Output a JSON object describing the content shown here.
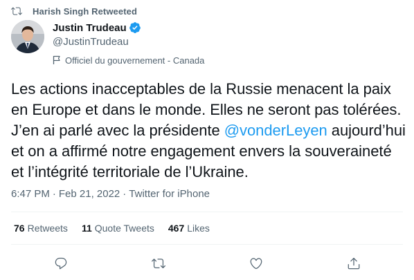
{
  "retweet_context": {
    "text": "Harish Singh Retweeted",
    "icon": "retweet-icon"
  },
  "author": {
    "display_name": "Justin Trudeau",
    "handle": "@JustinTrudeau",
    "verified": true,
    "label": "Officiel du gouvernement - Canada",
    "label_icon": "flag-icon"
  },
  "tweet": {
    "text_before": "Les actions inacceptables de la Russie menacent la paix en Europe et dans le monde. Elles ne seront pas tolérées. J’en ai parlé avec la présidente ",
    "mention": "@vonderLeyen",
    "text_after": " aujourd’hui et on a affirmé notre engagement envers la souveraineté et l’intégrité territoriale de l’Ukraine."
  },
  "meta": {
    "time": "6:47 PM",
    "separator": "·",
    "date": "Feb 21, 2022",
    "source": "Twitter for iPhone"
  },
  "stats": {
    "retweets_count": "76",
    "retweets_label": "Retweets",
    "quotes_count": "11",
    "quotes_label": "Quote Tweets",
    "likes_count": "467",
    "likes_label": "Likes"
  },
  "actions": [
    "reply-icon",
    "retweet-icon",
    "like-icon",
    "share-icon"
  ],
  "colors": {
    "accent": "#1d9bf0",
    "secondary_text": "#536471",
    "primary_text": "#0f1419",
    "divider": "#eff3f4"
  }
}
